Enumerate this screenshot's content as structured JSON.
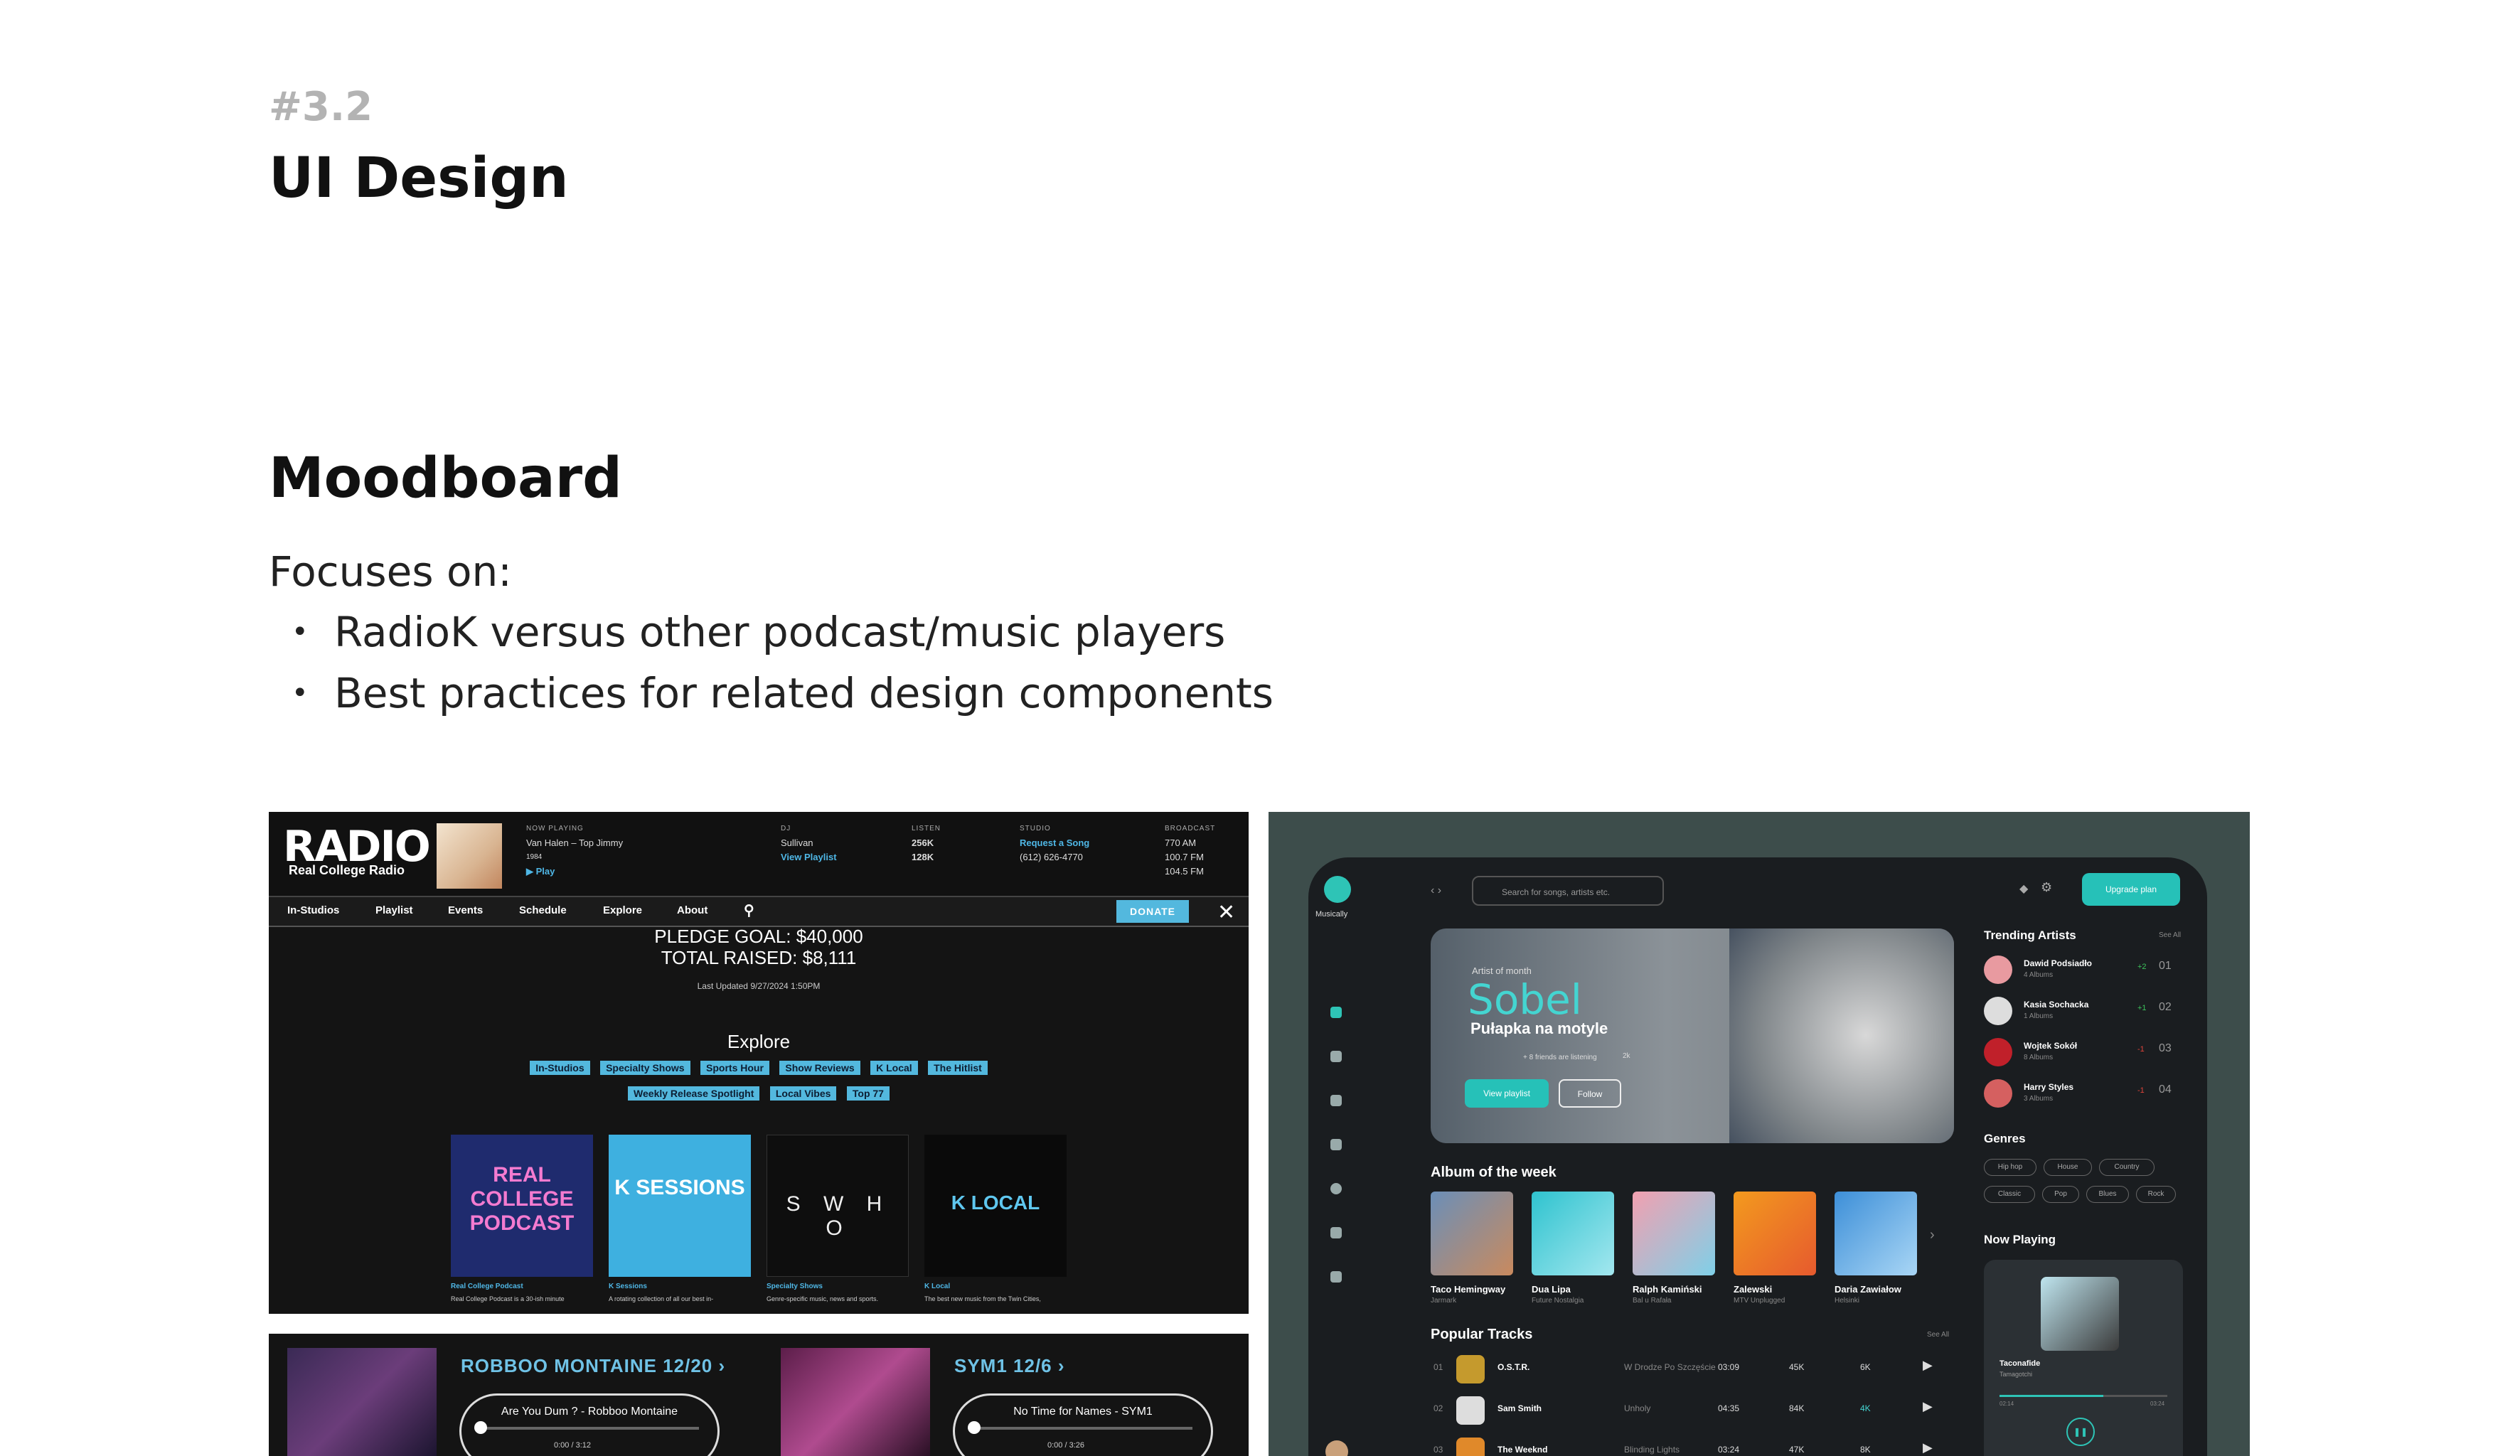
{
  "header": {
    "eyebrow": "#3.2",
    "title": "UI Design"
  },
  "moodboard": {
    "title": "Moodboard",
    "intro": "Focuses on:",
    "bullets": [
      "RadioK versus other podcast/music players",
      "Best practices for related design components"
    ]
  },
  "radiok": {
    "logo": "RADIO K",
    "logo_sub": "Real College Radio",
    "now_playing": {
      "label": "NOW PLAYING",
      "artist": "Van Halen – Top Jimmy",
      "year": "1984",
      "play": "▶ Play"
    },
    "dj": {
      "label": "DJ",
      "name": "Sullivan",
      "link": "View Playlist"
    },
    "listen": {
      "label": "LISTEN",
      "a": "256K",
      "b": "128K"
    },
    "studio": {
      "label": "STUDIO",
      "link": "Request a Song",
      "phone": "(612) 626-4770"
    },
    "broadcast": {
      "label": "BROADCAST",
      "a": "770 AM",
      "b": "100.7 FM",
      "c": "104.5 FM"
    },
    "nav": [
      "In-Studios",
      "Playlist",
      "Events",
      "Schedule",
      "Explore",
      "About"
    ],
    "donate": "DONATE",
    "pledge_goal": "PLEDGE GOAL: $40,000",
    "total_raised": "TOTAL RAISED: $8,111",
    "updated": "Last Updated 9/27/2024 1:50PM",
    "explore": "Explore",
    "tags_row1": [
      "In-Studios",
      "Specialty Shows",
      "Sports Hour",
      "Show Reviews",
      "K Local",
      "The Hitlist"
    ],
    "tags_row2": [
      "Weekly Release Spotlight",
      "Local Vibes",
      "Top 77"
    ],
    "cards": [
      {
        "art": "REAL COLLEGE PODCAST",
        "title": "Real College Podcast",
        "sub": "Real College Podcast is a 30-ish minute"
      },
      {
        "art": "K SESSIONS",
        "title": "K Sessions",
        "sub": "A rotating collection of all our best in-"
      },
      {
        "art": "S W H O",
        "title": "Specialty Shows",
        "sub": "Genre-specific music, news and sports."
      },
      {
        "art": "K LOCAL",
        "title": "K Local",
        "sub": "The best new music from the Twin Cities,"
      }
    ],
    "strip": [
      {
        "title": "ROBBOO MONTAINE 12/20 ›",
        "song": "Are You Dum ? - Robboo Montaine",
        "time": "0:00 / 3:12"
      },
      {
        "title": "SYM1 12/6 ›",
        "song": "No Time for Names - SYM1",
        "time": "0:00 / 3:26"
      }
    ]
  },
  "musically": {
    "brand": "Musically",
    "search_placeholder": "Search for songs, artists etc.",
    "upgrade": "Upgrade plan",
    "hero": {
      "label": "Artist of month",
      "title": "Sobel",
      "subtitle": "Pułapka na motyle",
      "friends": "+ 8 friends are listening",
      "likes": "2k",
      "btn_primary": "View playlist",
      "btn_secondary": "Follow"
    },
    "album_week": {
      "title": "Album of the week",
      "items": [
        {
          "name": "Taco Hemingway",
          "sub": "Jarmark"
        },
        {
          "name": "Dua Lipa",
          "sub": "Future Nostalgia"
        },
        {
          "name": "Ralph Kamiński",
          "sub": "Bal u Rafała"
        },
        {
          "name": "Zalewski",
          "sub": "MTV Unplugged"
        },
        {
          "name": "Daria Zawiałow",
          "sub": "Helsinki"
        }
      ]
    },
    "popular": {
      "title": "Popular Tracks",
      "see_all": "See All",
      "tracks": [
        {
          "n": "01",
          "title": "O.S.T.R.",
          "album": "W Drodze Po Szczęście",
          "time": "03:09",
          "plays": "45K",
          "likes": "6K"
        },
        {
          "n": "02",
          "title": "Sam Smith",
          "album": "Unholy",
          "time": "04:35",
          "plays": "84K",
          "likes": "4K"
        },
        {
          "n": "03",
          "title": "The Weeknd",
          "album": "Blinding Lights",
          "time": "03:24",
          "plays": "47K",
          "likes": "8K"
        }
      ]
    },
    "trending": {
      "title": "Trending Artists",
      "see_all": "See All",
      "artists": [
        {
          "name": "Dawid Podsiadło",
          "sub": "4 Albums",
          "delta": "+2",
          "rank": "01"
        },
        {
          "name": "Kasia Sochacka",
          "sub": "1 Albums",
          "delta": "+1",
          "rank": "02"
        },
        {
          "name": "Wojtek Sokół",
          "sub": "8 Albums",
          "delta": "-1",
          "rank": "03"
        },
        {
          "name": "Harry Styles",
          "sub": "3 Albums",
          "delta": "-1",
          "rank": "04"
        }
      ]
    },
    "genres": {
      "title": "Genres",
      "items": [
        "Hip hop",
        "House",
        "Country",
        "Classic",
        "Pop",
        "Blues",
        "Rock"
      ]
    },
    "now_playing": {
      "title": "Now Playing",
      "track": "Taconafide",
      "artist": "Tamagotchi",
      "elapsed": "02:14",
      "total": "03:24",
      "progress": 0.62
    }
  }
}
